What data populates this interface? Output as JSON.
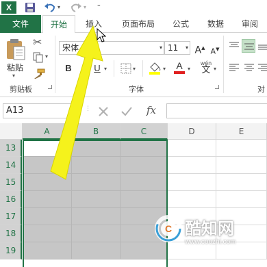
{
  "quick_access": {
    "app_logo": "X",
    "save_icon": "save-icon",
    "undo_icon": "undo-icon",
    "redo_icon": "redo-icon",
    "customize_icon": "customize-qat-icon"
  },
  "tabs": {
    "file": "文件",
    "items": [
      "开始",
      "插入",
      "页面布局",
      "公式",
      "数据",
      "审阅"
    ],
    "active": "开始"
  },
  "ribbon": {
    "clipboard": {
      "paste_label": "粘贴",
      "group_label": "剪贴板"
    },
    "font": {
      "font_name": "宋体",
      "font_size": "11",
      "bold": "B",
      "underline": "U",
      "font_color_letter": "A",
      "wen_label": "wén",
      "wen_char": "文",
      "group_label": "字体",
      "increase_size": "A",
      "decrease_size": "A"
    },
    "alignment": {
      "group_label_partial": "对"
    }
  },
  "formula_bar": {
    "name_box": "A13",
    "fx_label": "fx",
    "formula_value": ""
  },
  "grid": {
    "columns": [
      "A",
      "B",
      "C",
      "D",
      "E"
    ],
    "rows": [
      "13",
      "14",
      "15",
      "16",
      "17",
      "18",
      "19"
    ],
    "selected_range": "A13:C19",
    "active_cell": "A13"
  },
  "watermark": {
    "logo_letter": "C",
    "name": "酷知网",
    "url": "www.coozhi.com"
  },
  "colors": {
    "excel_green": "#217346",
    "arrow_yellow": "#f5f21c",
    "selection_gray": "#c6c6c6"
  }
}
